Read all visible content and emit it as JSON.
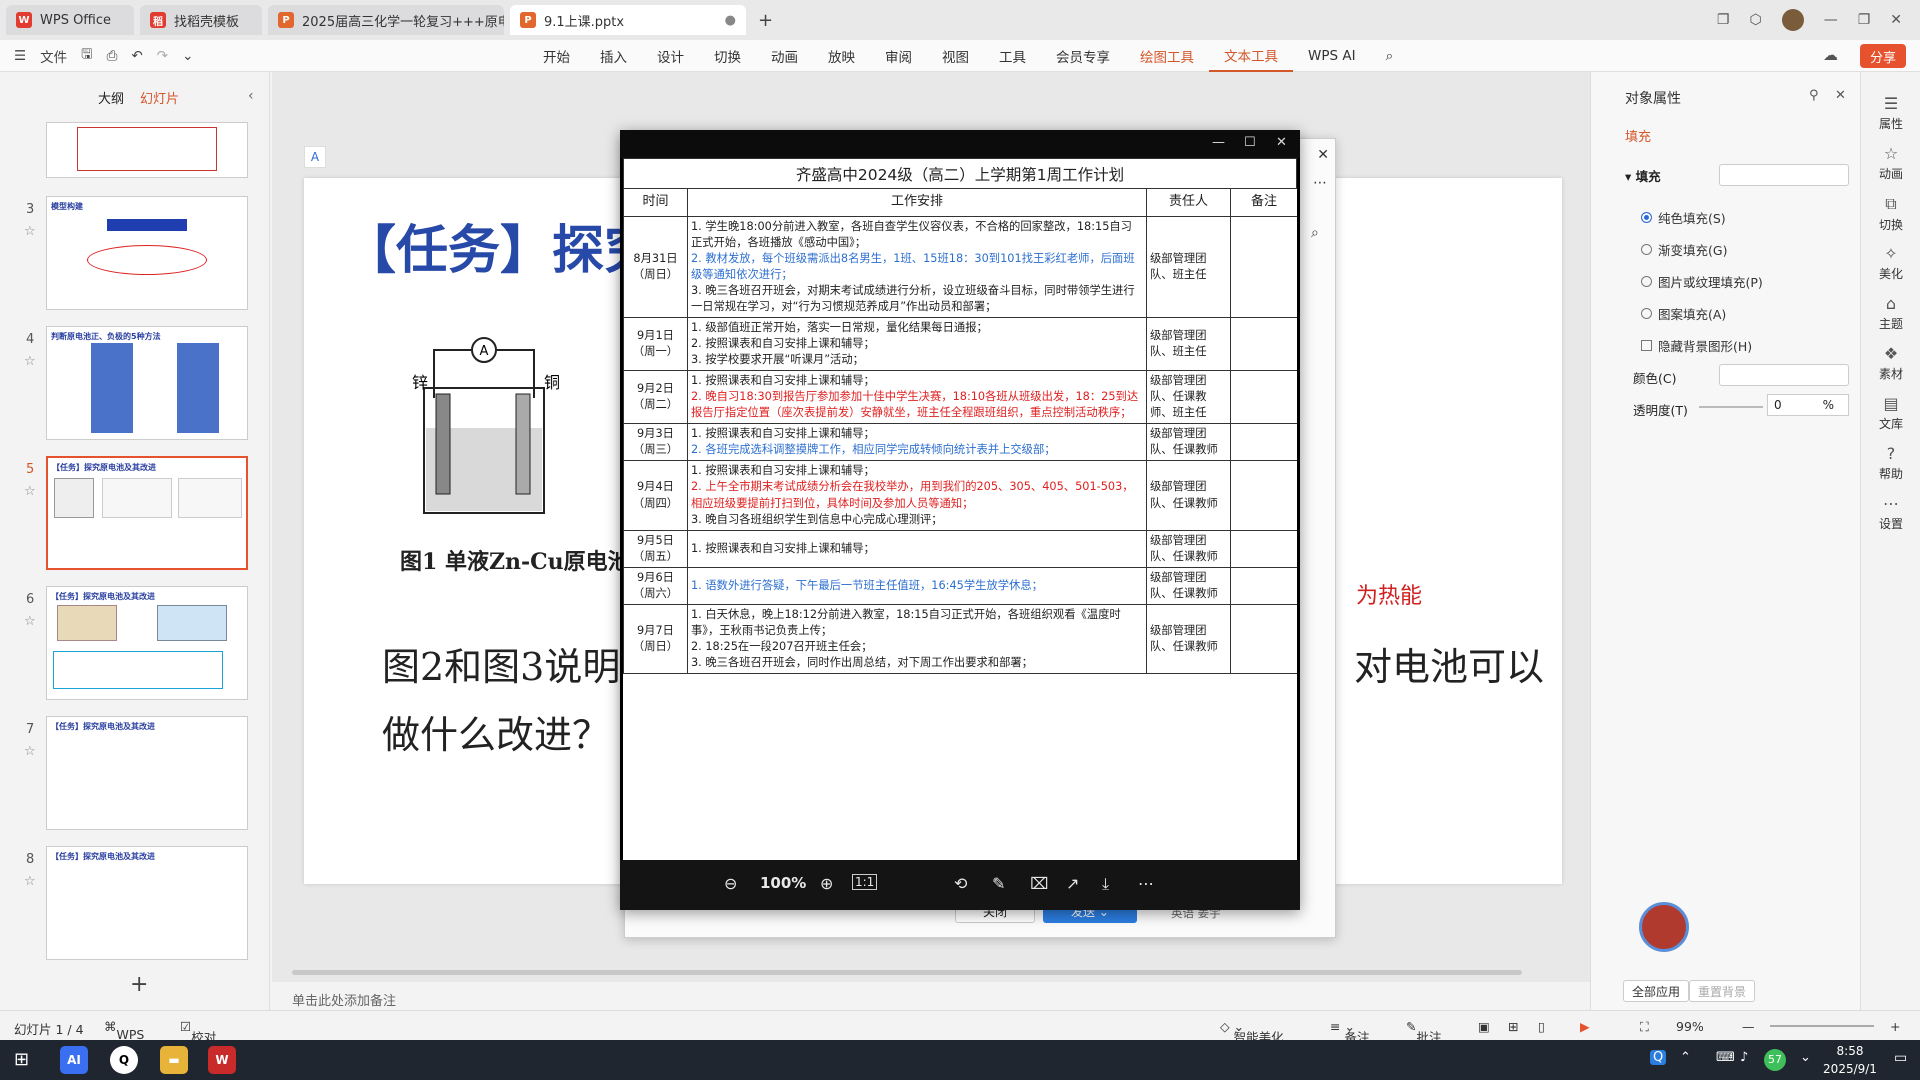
{
  "window_tabs": [
    {
      "label": "WPS Office",
      "icon": "W",
      "color": "#e23b2f"
    },
    {
      "label": "找稻壳模板",
      "icon": "稻",
      "color": "#e23b2f"
    },
    {
      "label": "2025届高三化学一轮复习+++原电池",
      "icon": "P",
      "color": "#e2672d"
    },
    {
      "label": "9.1上课.pptx",
      "icon": "P",
      "color": "#e2672d"
    }
  ],
  "ribbon": {
    "file_label": "文件",
    "menus": [
      "开始",
      "插入",
      "设计",
      "切换",
      "动画",
      "放映",
      "审阅",
      "视图",
      "工具",
      "会员专享",
      "绘图工具",
      "文本工具",
      "WPS AI"
    ],
    "share_label": "分享"
  },
  "left_panel": {
    "tab_outline": "大纲",
    "tab_slides": "幻灯片",
    "slides": [
      {
        "num": "",
        "title": ""
      },
      {
        "num": "3",
        "title": "模型构建"
      },
      {
        "num": "4",
        "title": "判断原电池正、负极的5种方法"
      },
      {
        "num": "5",
        "title": "【任务】探究原电池及其改进"
      },
      {
        "num": "6",
        "title": "【任务】探究原电池及其改进"
      },
      {
        "num": "7",
        "title": "【任务】探究原电池及其改进"
      },
      {
        "num": "8",
        "title": "【任务】探究原电池及其改进"
      }
    ],
    "add_label": "+"
  },
  "slide": {
    "title": "【任务】探究",
    "caption": "图1 单液Zn-Cu原电池装",
    "body_line1": "图2和图3说明单",
    "body_line2": "做什么改进？",
    "body_right": "对电池可以",
    "red_text": "为热能",
    "labels": {
      "zinc": "锌",
      "copper": "铜",
      "ammeter": "A"
    }
  },
  "notes_placeholder": "单击此处添加备注",
  "viewer": {
    "zoom": "100%",
    "ratio": "1:1",
    "doc_title": "齐盛高中2024级（高二）上学期第1周工作计划",
    "headers": [
      "时间",
      "工作安排",
      "责任人",
      "备注"
    ],
    "rows": [
      {
        "date": "8月31日",
        "weekday": "（周日）",
        "owner": "级部管理团队、班主任",
        "items": [
          {
            "text": "1. 学生晚18:00分前进入教室，各班自查学生仪容仪表，不合格的回家整改，18:15自习正式开始，各班播放《感动中国》；",
            "color": "black"
          },
          {
            "text": "2. 教材发放，每个班级需派出8名男生，1班、15班18：30到101找王彩红老师，后面班级等通知依次进行；",
            "color": "blue"
          },
          {
            "text": "3. 晚三各班召开班会，对期末考试成绩进行分析，设立班级奋斗目标，同时带领学生进行一日常规在学习，对“行为习惯规范养成月”作出动员和部署；",
            "color": "black"
          }
        ]
      },
      {
        "date": "9月1日",
        "weekday": "（周一）",
        "owner": "级部管理团队、班主任",
        "items": [
          {
            "text": "1. 级部值班正常开始，落实一日常规，量化结果每日通报；",
            "color": "black"
          },
          {
            "text": "2. 按照课表和自习安排上课和辅导；",
            "color": "black"
          },
          {
            "text": "3. 按学校要求开展“听课月”活动；",
            "color": "black"
          }
        ]
      },
      {
        "date": "9月2日",
        "weekday": "（周二）",
        "owner": "级部管理团队、任课教师、班主任",
        "items": [
          {
            "text": "1. 按照课表和自习安排上课和辅导；",
            "color": "black"
          },
          {
            "text": "2. 晚自习18:30到报告厅参加参加十佳中学生决赛，18:10各班从班级出发，18：25到达报告厅指定位置（座次表提前发）安静就坐，班主任全程跟班组织，重点控制活动秩序；",
            "color": "red"
          }
        ]
      },
      {
        "date": "9月3日",
        "weekday": "（周三）",
        "owner": "级部管理团队、任课教师",
        "items": [
          {
            "text": "1. 按照课表和自习安排上课和辅导；",
            "color": "black"
          },
          {
            "text": "2. 各班完成选科调整摸牌工作，相应同学完成转倾向统计表并上交级部；",
            "color": "blue"
          }
        ]
      },
      {
        "date": "9月4日",
        "weekday": "（周四）",
        "owner": "级部管理团队、任课教师",
        "items": [
          {
            "text": "1. 按照课表和自习安排上课和辅导；",
            "color": "black"
          },
          {
            "text": "2. 上午全市期末考试成绩分析会在我校举办，用到我们的205、305、405、501-503，相应班级要提前打扫到位，具体时间及参加人员等通知；",
            "color": "red"
          },
          {
            "text": "3. 晚自习各班组织学生到信息中心完成心理测评；",
            "color": "black"
          }
        ]
      },
      {
        "date": "9月5日",
        "weekday": "（周五）",
        "owner": "级部管理团队、任课教师",
        "items": [
          {
            "text": "1. 按照课表和自习安排上课和辅导；",
            "color": "black"
          }
        ]
      },
      {
        "date": "9月6日",
        "weekday": "（周六）",
        "owner": "级部管理团队、任课教师",
        "items": [
          {
            "text": "1. 语数外进行答疑，下午最后一节班主任值班，16:45学生放学休息；",
            "color": "blue"
          }
        ]
      },
      {
        "date": "9月7日",
        "weekday": "（周日）",
        "owner": "级部管理团队、任课教师",
        "items": [
          {
            "text": "1. 白天休息，晚上18:12分前进入教室，18:15自习正式开始，各班组织观看《温度时事》，王秋雨书记负责上传；",
            "color": "black"
          },
          {
            "text": "2. 18:25在一段207召开班主任会；",
            "color": "black"
          },
          {
            "text": "3. 晚三各班召开班会，同时作出周总结，对下周工作出要求和部署；",
            "color": "black"
          }
        ]
      }
    ]
  },
  "popup_back": {
    "close_label": "关闭",
    "confirm_label": "发送",
    "user_label": "英语 姜宇"
  },
  "right_panel": {
    "title": "对象属性",
    "tab_fill": "填充",
    "section_fill": "填充",
    "options": [
      "纯色填充(S)",
      "渐变填充(G)",
      "图片或纹理填充(P)",
      "图案填充(A)"
    ],
    "hide_bg": "隐藏背景图形(H)",
    "color_label": "颜色(C)",
    "transparency_label": "透明度(T)",
    "transparency_value": "0",
    "transparency_unit": "%",
    "apply_all": "全部应用",
    "reset_bg": "重置背景"
  },
  "right_sidebar": [
    "属性",
    "动画",
    "切换",
    "美化",
    "主题",
    "素材",
    "文库",
    "帮助",
    "设置"
  ],
  "status": {
    "slide_info": "幻灯片 1 / 4",
    "theme": "WPS",
    "proofread": "校对",
    "smart_beautify": "智能美化",
    "notes": "备注",
    "comments": "批注",
    "zoom": "99%"
  },
  "taskbar": {
    "time": "8:58",
    "date": "2025/9/1",
    "badge": "57"
  }
}
